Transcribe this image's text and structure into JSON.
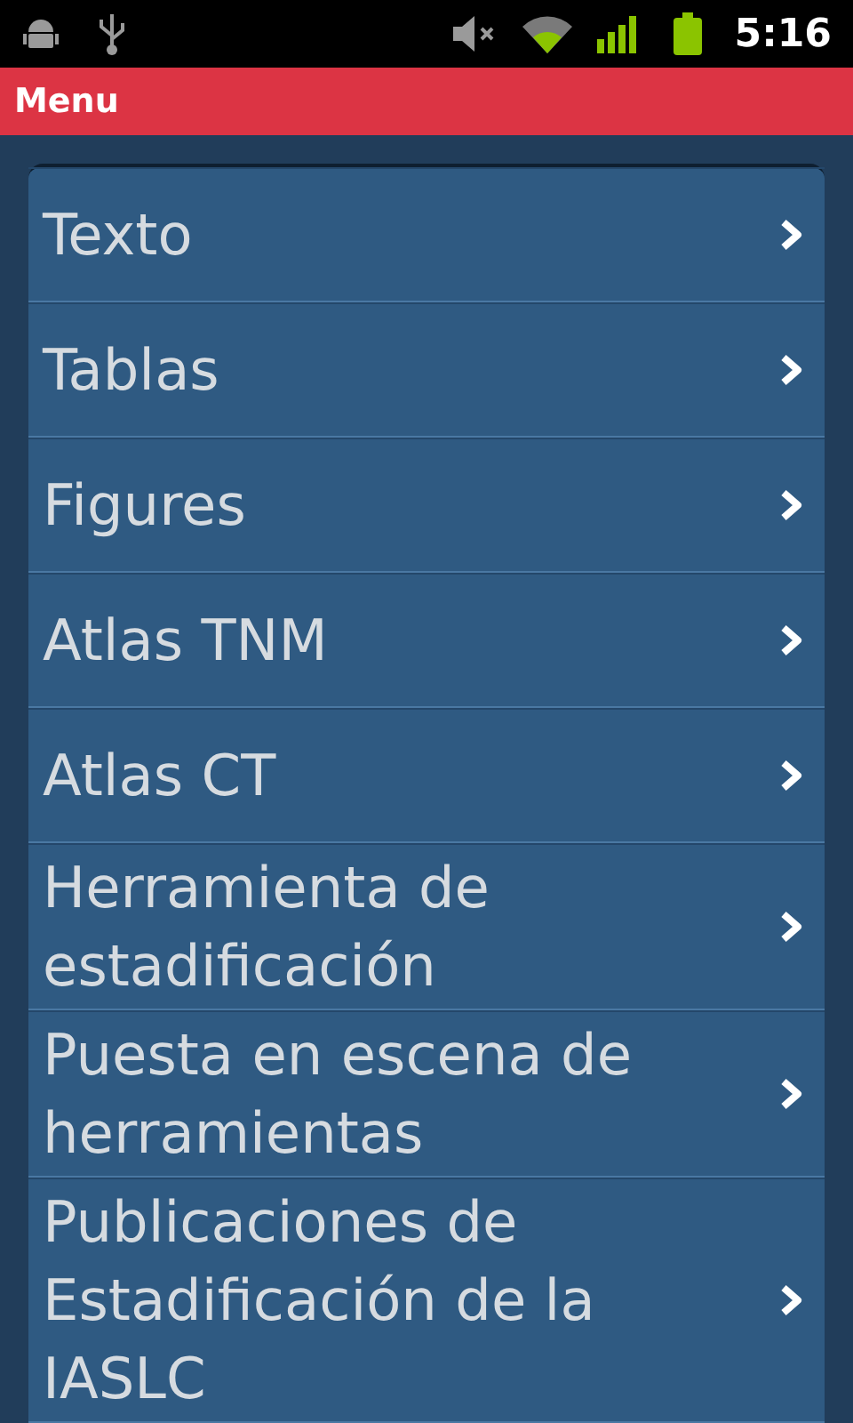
{
  "status_bar": {
    "time": "5:16"
  },
  "header": {
    "title": "Menu"
  },
  "menu": {
    "items": [
      {
        "label": "Texto"
      },
      {
        "label": "Tablas"
      },
      {
        "label": "Figures"
      },
      {
        "label": "Atlas TNM"
      },
      {
        "label": "Atlas CT"
      },
      {
        "label": "Herramienta de estadificación"
      },
      {
        "label": "Puesta en escena de herramientas"
      },
      {
        "label": "Publicaciones de Estadificación de la IASLC"
      }
    ]
  }
}
